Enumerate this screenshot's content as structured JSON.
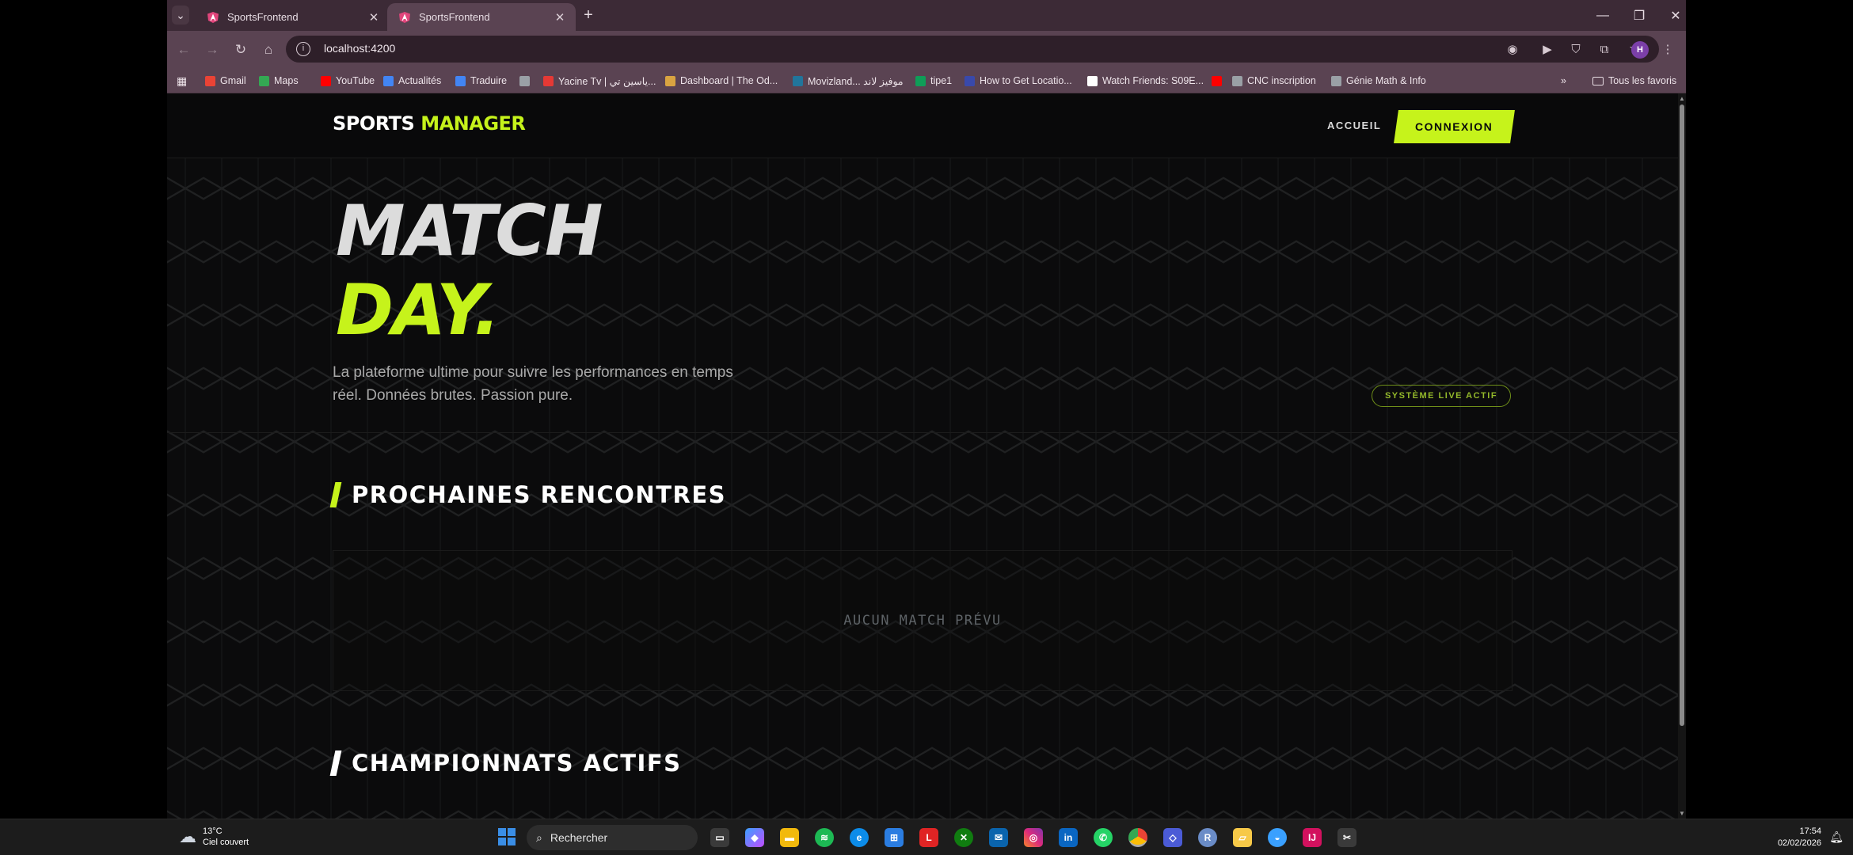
{
  "browser": {
    "tabs": [
      {
        "title": "SportsFrontend",
        "active": false
      },
      {
        "title": "SportsFrontend",
        "active": true
      }
    ],
    "url": "localhost:4200",
    "profile_initial": "H",
    "bookmarks": [
      {
        "label": "Gmail",
        "icon": "gmail-icon",
        "color": "#ea4335"
      },
      {
        "label": "Maps",
        "icon": "maps-icon",
        "color": "#34a853"
      },
      {
        "label": "YouTube",
        "icon": "youtube-icon",
        "color": "#ff0000"
      },
      {
        "label": "Actualités",
        "icon": "news-icon",
        "color": "#4285f4"
      },
      {
        "label": "Traduire",
        "icon": "translate-icon",
        "color": "#4285f4"
      },
      {
        "label": "",
        "icon": "globe-icon",
        "color": "#9aa0a6"
      },
      {
        "label": "Yacine Tv | ياسين تي...",
        "icon": "yacine-icon",
        "color": "#e53935"
      },
      {
        "label": "Dashboard | The Od...",
        "icon": "odin-icon",
        "color": "#d9a441"
      },
      {
        "label": "Movizland... موفيز لاند",
        "icon": "wordpress-icon",
        "color": "#21759b"
      },
      {
        "label": "tipe1",
        "icon": "drive-icon",
        "color": "#0f9d58"
      },
      {
        "label": "How to Get Locatio...",
        "icon": "site-icon",
        "color": "#3949ab"
      },
      {
        "label": "Watch Friends: S09E...",
        "icon": "page-icon",
        "color": "#ffffff"
      },
      {
        "label": "",
        "icon": "youtube-icon",
        "color": "#ff0000"
      },
      {
        "label": "CNC inscription",
        "icon": "globe-icon",
        "color": "#9aa0a6"
      },
      {
        "label": "Génie Math & Info",
        "icon": "gear-site-icon",
        "color": "#9aa0a6"
      }
    ],
    "all_bookmarks": "Tous les favoris"
  },
  "site": {
    "logo_main": "SPORTS",
    "logo_accent": "MANAGER",
    "nav_home": "ACCUEIL",
    "nav_login": "CONNEXION",
    "hero_line1": "MATCH",
    "hero_line2": "DAY.",
    "hero_subtitle": "La plateforme ultime pour suivre les performances en temps réel. Données brutes. Passion pure.",
    "live_badge": "SYSTÈME LIVE ACTIF",
    "section_upcoming": "PROCHAINES RENCONTRES",
    "empty_matches": "AUCUN MATCH PRÉVU",
    "section_leagues": "CHAMPIONNATS ACTIFS",
    "accent_color": "#c6f31b"
  },
  "taskbar": {
    "temperature": "13°C",
    "weather": "Ciel couvert",
    "search_placeholder": "Rechercher",
    "time": "17:54",
    "date": "02/02/2026"
  }
}
